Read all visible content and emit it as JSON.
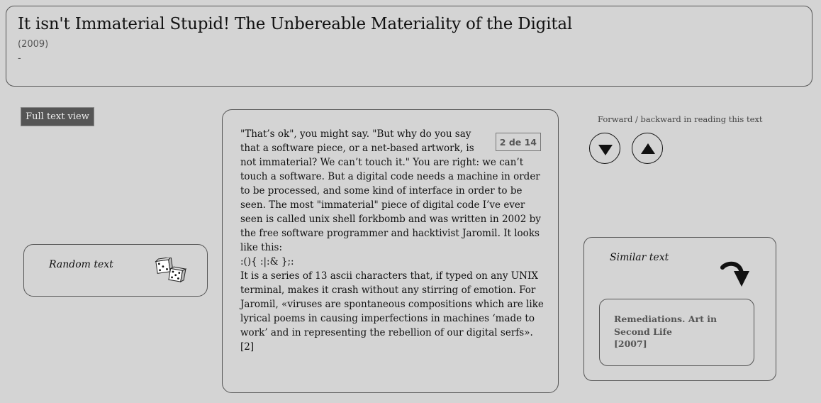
{
  "header": {
    "title": "It isn't Immaterial Stupid! The Unbereable Materiality of the Digital",
    "year": "(2009)",
    "dash": "-"
  },
  "full_text_view": {
    "label": "Full text view"
  },
  "random_text": {
    "label": "Random text",
    "icon": "dice-icon"
  },
  "reader": {
    "page_counter": "2 de 14",
    "paragraphs": [
      "\"That’s ok\", you might say. \"But why do you say that a software piece, or a net-based artwork, is not immaterial? We can’t touch it.\" You are right: we can’t touch a software. But a digital code needs a machine in order to be processed, and some kind of interface in order to be seen. The most \"immaterial\" piece of digital code I’ve ever seen is called unix shell forkbomb and was written in 2002 by the free software programmer and hacktivist Jaromil. It looks like this:",
      ":(){ :|:& };:",
      "It is a series of 13 ascii characters that, if typed on any UNIX terminal, makes it crash without any stirring of emotion. For Jaromil, «viruses are spontaneous compositions which are like lyrical poems in causing imperfections in machines ‘made to work’ and in representing the rebellion of our digital serfs». [2]"
    ]
  },
  "navigation": {
    "label": "Forward / backward in reading this text",
    "forward_icon": "arrow-down-icon",
    "backward_icon": "arrow-up-icon"
  },
  "similar": {
    "label": "Similar text",
    "icon": "curved-arrow-icon",
    "item": {
      "title": "Remediations. Art in Second Life",
      "year": "[2007]"
    }
  }
}
